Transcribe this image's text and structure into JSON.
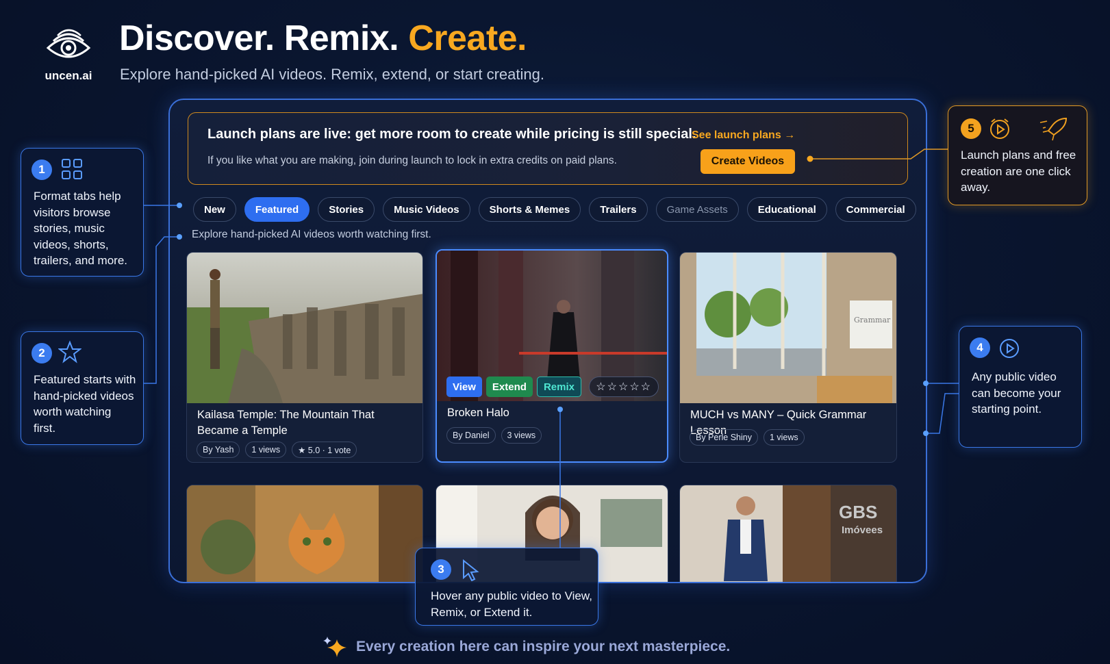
{
  "brand": {
    "name": "uncen.ai"
  },
  "header": {
    "headline_part1": "Discover. Remix.",
    "headline_part2": "Create.",
    "subhead": "Explore hand-picked AI videos. Remix, extend, or start creating."
  },
  "banner": {
    "title": "Launch plans are live: get more room to create while pricing is still special.",
    "link": "See launch plans →",
    "body": "If you like what you are making, join during launch to lock in extra credits on paid plans.",
    "cta": "Create Videos"
  },
  "tabs": [
    {
      "label": "New"
    },
    {
      "label": "Featured"
    },
    {
      "label": "Stories"
    },
    {
      "label": "Music Videos"
    },
    {
      "label": "Shorts & Memes"
    },
    {
      "label": "Trailers"
    },
    {
      "label": "Game Assets"
    },
    {
      "label": "Educational"
    },
    {
      "label": "Commercial"
    }
  ],
  "tab_caption": "Explore hand-picked AI videos worth watching first.",
  "cards": [
    {
      "title": "Kailasa Temple: The Mountain That Became a Temple",
      "author": "By Yash",
      "views": "1 views",
      "rating": "★ 5.0 · 1 vote"
    },
    {
      "title": "Broken Halo",
      "author": "By Daniel",
      "views": "3 views",
      "actions": {
        "view": "View",
        "extend": "Extend",
        "remix": "Remix"
      },
      "stars": "☆☆☆☆☆"
    },
    {
      "title": "MUCH vs MANY – Quick Grammar Lesson",
      "author": "By Perle Shiny",
      "views": "1 views",
      "whiteboard": "Grammar"
    }
  ],
  "bottom_cards": [
    {
      "sign": "GBS\nImóveis",
      "sign_line1": "GBS",
      "sign_line2": "Imóvees"
    }
  ],
  "callouts": [
    {
      "num": "1",
      "text": "Format tabs help visitors browse stories, music videos, shorts, trailers, and more."
    },
    {
      "num": "2",
      "text": "Featured starts with hand-picked videos worth watching first."
    },
    {
      "num": "3",
      "text": "Hover any public video to View, Remix, or Extend it."
    },
    {
      "num": "4",
      "text": "Any public video can become your starting point."
    },
    {
      "num": "5",
      "text": "Launch plans and free creation are one click away."
    }
  ],
  "footer": {
    "text": "Every creation here can inspire your next masterpiece."
  },
  "colors": {
    "accent_orange": "#f8a820",
    "accent_blue": "#2e6ef0",
    "background": "#0a1630"
  }
}
